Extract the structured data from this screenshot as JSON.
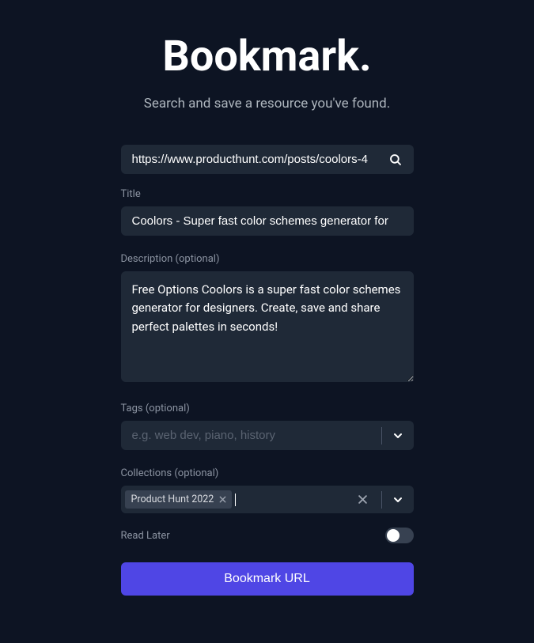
{
  "heading": "Bookmark.",
  "subtitle": "Search and save a resource you've found.",
  "url": {
    "value": "https://www.producthunt.com/posts/coolors-4"
  },
  "title": {
    "label": "Title",
    "value": "Coolors - Super fast color schemes generator for"
  },
  "description": {
    "label": "Description (optional)",
    "value": "Free Options Coolors is a super fast color schemes generator for designers. Create, save and share perfect palettes in seconds!"
  },
  "tags": {
    "label": "Tags (optional)",
    "placeholder": "e.g. web dev, piano, history"
  },
  "collections": {
    "label": "Collections (optional)",
    "chip": "Product Hunt 2022"
  },
  "read_later": {
    "label": "Read Later",
    "enabled": false
  },
  "submit_label": "Bookmark URL"
}
